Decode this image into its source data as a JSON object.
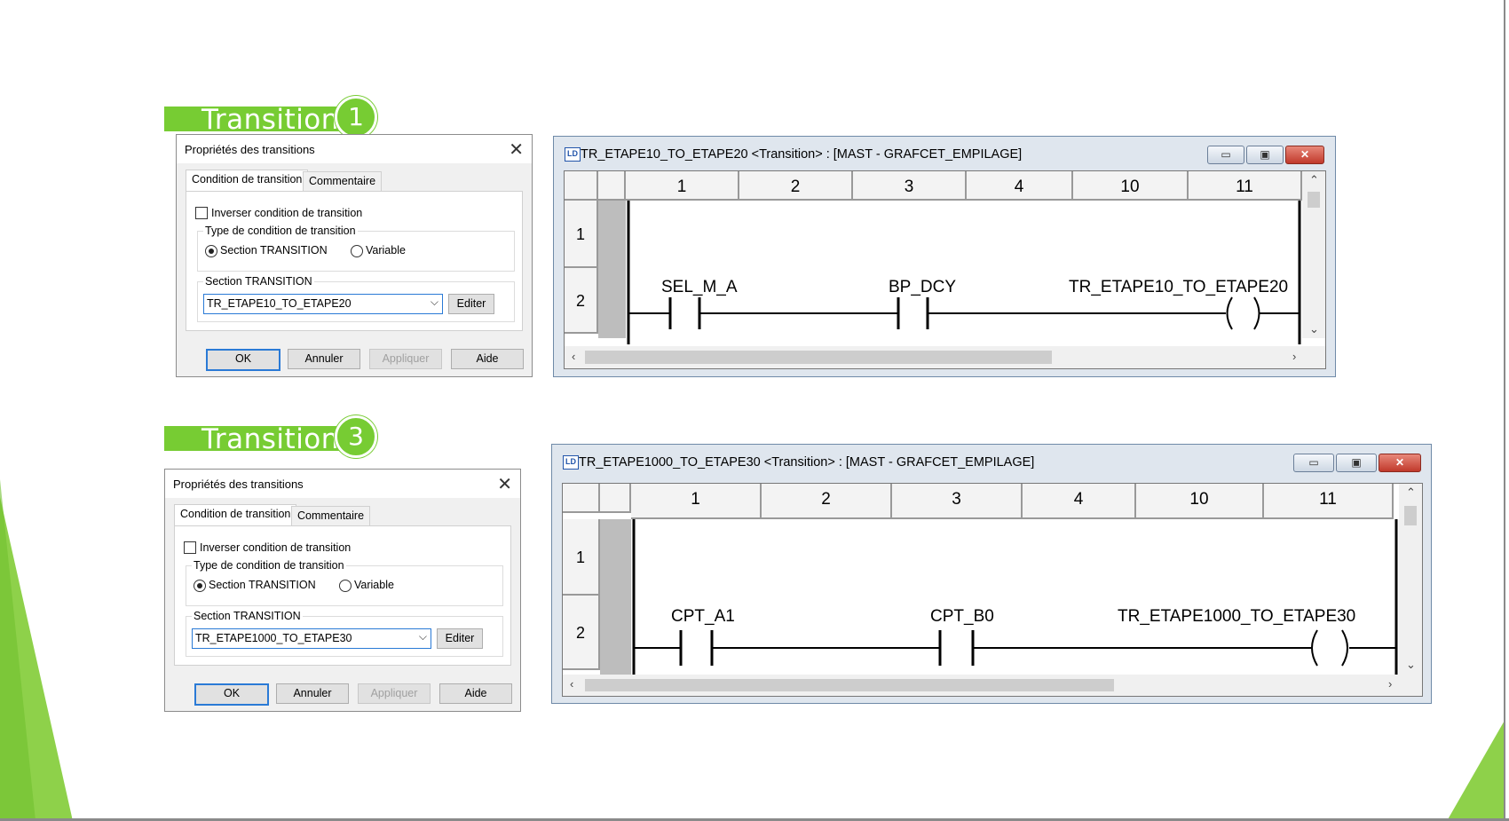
{
  "transitions": [
    {
      "banner": {
        "label": "Transition",
        "number": "1"
      },
      "dialog": {
        "title": "Propriétés des transitions",
        "close_glyph": "✕",
        "tabs": [
          "Condition de transition",
          "Commentaire"
        ],
        "invert_label": "Inverser condition de transition",
        "type_group_title": "Type de condition de transition",
        "radio_section_label": "Section TRANSITION",
        "radio_variable_label": "Variable",
        "section_group_title": "Section TRANSITION",
        "section_value": "TR_ETAPE10_TO_ETAPE20",
        "edit_button": "Editer",
        "buttons": {
          "ok": "OK",
          "cancel": "Annuler",
          "apply": "Appliquer",
          "help": "Aide"
        }
      },
      "window": {
        "icon": "LD",
        "title": "TR_ETAPE10_TO_ETAPE20 <Transition> : [MAST - GRAFCET_EMPILAGE]",
        "columns": [
          "1",
          "2",
          "3",
          "4",
          "10",
          "11"
        ],
        "rows": [
          "1",
          "2"
        ],
        "contact1": "SEL_M_A",
        "contact2": "BP_DCY",
        "coil": "TR_ETAPE10_TO_ETAPE20"
      }
    },
    {
      "banner": {
        "label": "Transition",
        "number": "3"
      },
      "dialog": {
        "title": "Propriétés des transitions",
        "close_glyph": "✕",
        "tabs": [
          "Condition de transition",
          "Commentaire"
        ],
        "invert_label": "Inverser condition de transition",
        "type_group_title": "Type de condition de transition",
        "radio_section_label": "Section TRANSITION",
        "radio_variable_label": "Variable",
        "section_group_title": "Section TRANSITION",
        "section_value": "TR_ETAPE1000_TO_ETAPE30",
        "edit_button": "Editer",
        "buttons": {
          "ok": "OK",
          "cancel": "Annuler",
          "apply": "Appliquer",
          "help": "Aide"
        }
      },
      "window": {
        "icon": "LD",
        "title": "TR_ETAPE1000_TO_ETAPE30 <Transition> : [MAST - GRAFCET_EMPILAGE]",
        "columns": [
          "1",
          "2",
          "3",
          "4",
          "10",
          "11"
        ],
        "rows": [
          "1",
          "2"
        ],
        "contact1": "CPT_A1",
        "contact2": "CPT_B0",
        "coil": "TR_ETAPE1000_TO_ETAPE30"
      }
    }
  ],
  "colors": {
    "accent_green": "#77cc33",
    "close_red": "#c0392b",
    "focus_blue": "#2a7ad6"
  }
}
